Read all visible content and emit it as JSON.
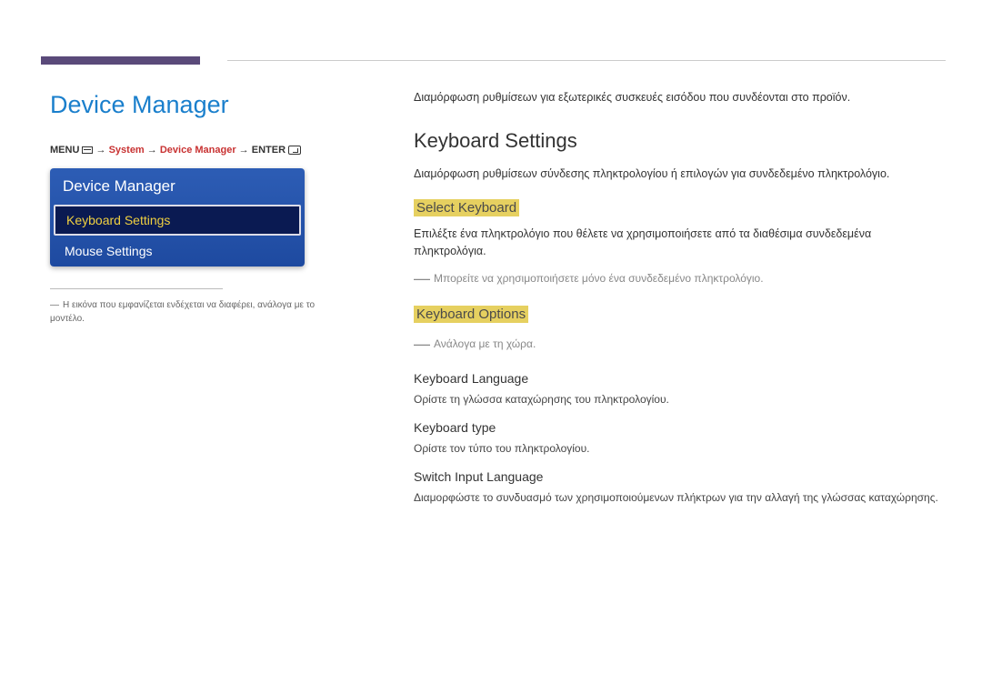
{
  "page_title": "Device Manager",
  "breadcrumb": {
    "menu": "MENU",
    "arrow": "→",
    "system": "System",
    "device_manager": "Device Manager",
    "enter": "ENTER"
  },
  "panel": {
    "title": "Device Manager",
    "items": [
      {
        "label": "Keyboard Settings",
        "selected": true
      },
      {
        "label": "Mouse Settings",
        "selected": false
      }
    ]
  },
  "left_footnote": "Η εικόνα που εμφανίζεται ενδέχεται να διαφέρει, ανάλογα με το μοντέλο.",
  "right": {
    "intro": "Διαμόρφωση ρυθμίσεων για εξωτερικές συσκευές εισόδου που συνδέονται στο προϊόν.",
    "keyboard_settings": {
      "title": "Keyboard Settings",
      "desc": "Διαμόρφωση ρυθμίσεων σύνδεσης πληκτρολογίου ή επιλογών για συνδεδεμένο πληκτρολόγιο."
    },
    "select_keyboard": {
      "title": "Select Keyboard",
      "desc": "Επιλέξτε ένα πληκτρολόγιο που θέλετε να χρησιμοποιήσετε από τα διαθέσιμα συνδεδεμένα πληκτρολόγια.",
      "note": "Μπορείτε να χρησιμοποιήσετε μόνο ένα συνδεδεμένο πληκτρολόγιο."
    },
    "keyboard_options": {
      "title": "Keyboard Options",
      "note": "Ανάλογα με τη χώρα.",
      "keyboard_language": {
        "title": "Keyboard Language",
        "desc": "Ορίστε τη γλώσσα καταχώρησης του πληκτρολογίου."
      },
      "keyboard_type": {
        "title": "Keyboard type",
        "desc": "Ορίστε τον τύπο του πληκτρολογίου."
      },
      "switch_input_language": {
        "title": "Switch Input Language",
        "desc": "Διαμορφώστε το συνδυασμό των χρησιμοποιούμενων πλήκτρων για την αλλαγή της γλώσσας καταχώρησης."
      }
    }
  }
}
